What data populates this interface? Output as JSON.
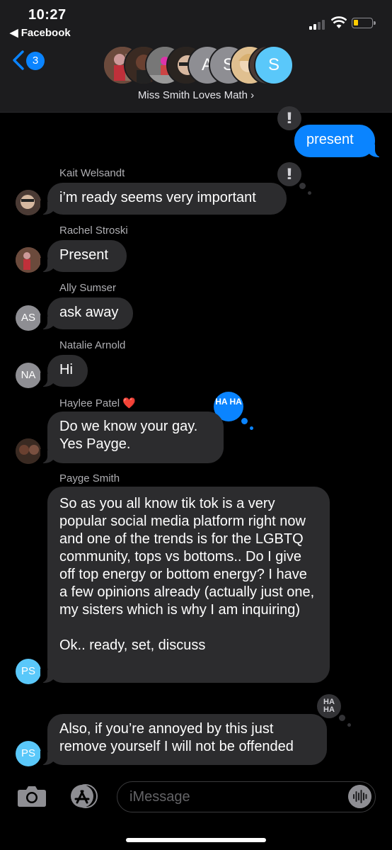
{
  "status": {
    "time": "10:27",
    "back_app": "◀ Facebook"
  },
  "nav": {
    "badge": "3",
    "group_name": "Miss Smith Loves Math ›"
  },
  "group_avatars": [
    {
      "initials": "",
      "color": "#7a5a4a"
    },
    {
      "initials": "",
      "color": "#4a3a30"
    },
    {
      "initials": "",
      "color": "#6a6a6a"
    },
    {
      "initials": "",
      "color": "#3a2f2a"
    },
    {
      "initials": "A",
      "color": "#8e8e93"
    },
    {
      "initials": "S",
      "color": "#8e8e93"
    },
    {
      "initials": "",
      "color": "#c8a070"
    },
    {
      "initials": "",
      "color": "#5a4a40"
    },
    {
      "initials": "S",
      "color": "#5ac8fa"
    }
  ],
  "messages": [
    {
      "sender": "",
      "text": "present",
      "from_me": true,
      "tapback": "!!"
    },
    {
      "sender": "Kait Welsandt",
      "text": "i’m ready seems very important",
      "avatar": "photo",
      "tapback": "!!"
    },
    {
      "sender": "Rachel Stroski",
      "text": "Present",
      "avatar": "photo"
    },
    {
      "sender": "Ally Sumser",
      "text": "ask away",
      "avatar": "AS"
    },
    {
      "sender": "Natalie Arnold",
      "text": "Hi",
      "avatar": "NA"
    },
    {
      "sender": "Haylee Patel",
      "sender_emoji": "❤️",
      "text": "Do we know your gay.\nYes Payge.",
      "avatar": "photo",
      "tapback": "HA HA"
    },
    {
      "sender": "Payge Smith",
      "text": "So as you all know tik tok is a very popular social media platform right now and one of the trends is for the LGBTQ community, tops vs bottoms.. Do I give off top energy or bottom energy? I have a few opinions already (actually just one, my sisters which is why I am inquiring)\n\nOk.. ready, set, discuss",
      "avatar": "PS"
    },
    {
      "sender": "",
      "text": "Also, if you’re annoyed by this just remove yourself I will not be offended",
      "avatar": "PS",
      "tapback": "HA HA"
    }
  ],
  "composer": {
    "placeholder": "iMessage"
  },
  "icons": {
    "camera": "camera-icon",
    "appstore": "app-store-icon",
    "audio": "audio-waveform-icon"
  }
}
